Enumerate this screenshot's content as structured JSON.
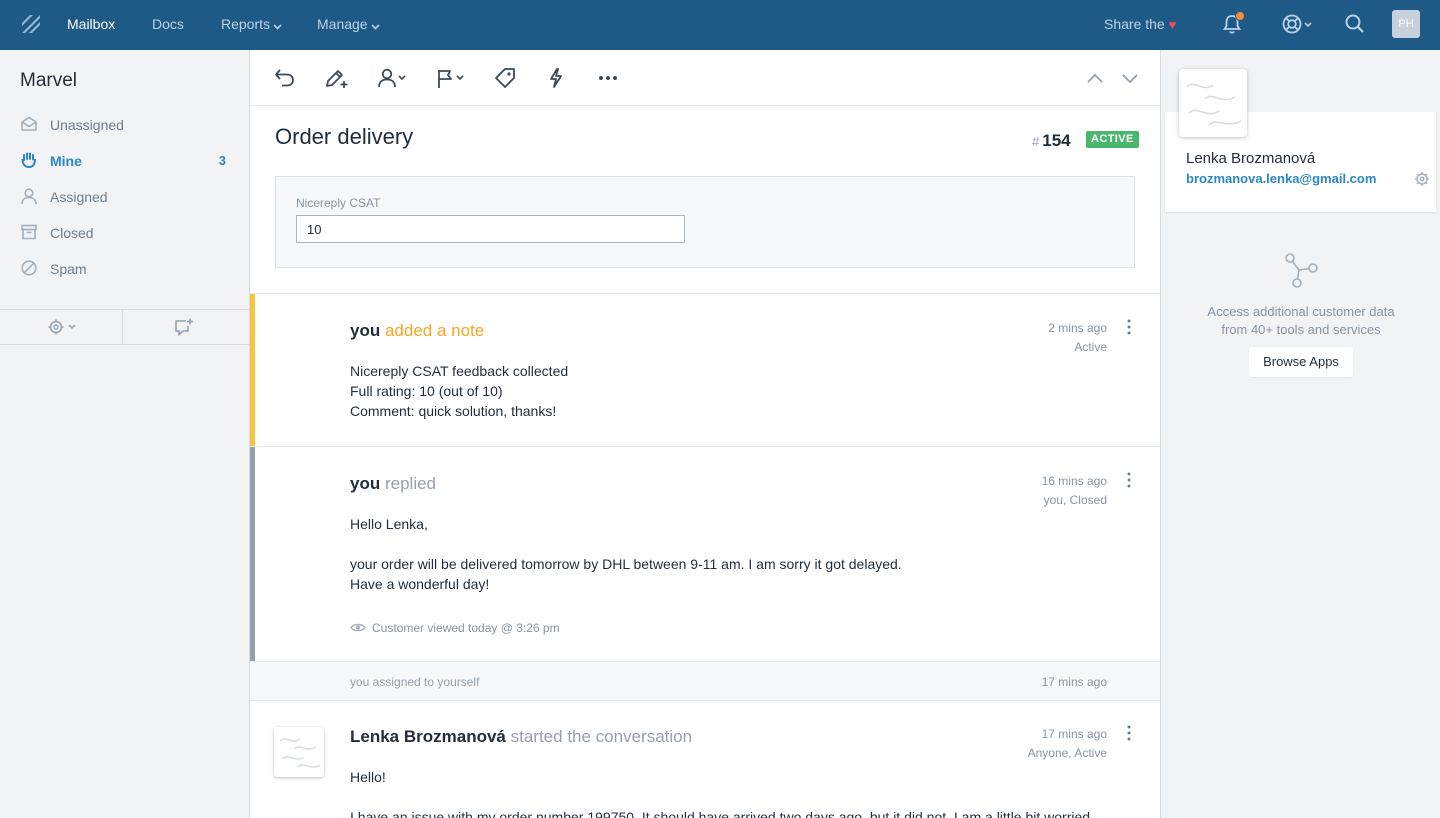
{
  "topnav": {
    "items": [
      {
        "label": "Mailbox"
      },
      {
        "label": "Docs"
      },
      {
        "label": "Reports"
      },
      {
        "label": "Manage"
      }
    ],
    "share_label": "Share the",
    "avatar_initials": "PH",
    "icons": [
      "logo-icon",
      "bell-icon",
      "help-icon",
      "search-icon"
    ],
    "colors": {
      "bar": "#1f5a87",
      "notification_dot": "#f68b32"
    }
  },
  "sidebar": {
    "mailbox_name": "Marvel",
    "folders": [
      {
        "label": "Unassigned",
        "icon": "envelope-open-icon"
      },
      {
        "label": "Mine",
        "icon": "hand-icon",
        "count": "3"
      },
      {
        "label": "Assigned",
        "icon": "person-icon"
      },
      {
        "label": "Closed",
        "icon": "archive-icon"
      },
      {
        "label": "Spam",
        "icon": "ban-icon"
      }
    ],
    "tools": [
      "settings-icon",
      "new-conversation-icon"
    ]
  },
  "conversation": {
    "toolbar_icons": [
      "undo-icon",
      "note-pen-icon",
      "assign-person-icon",
      "flag-status-icon",
      "tag-icon",
      "workflow-bolt-icon",
      "more-icon",
      "prev-icon",
      "next-icon"
    ],
    "subject": "Order delivery",
    "number_prefix": "#",
    "number": "154",
    "status": "ACTIVE",
    "custom_field": {
      "label": "Nicereply CSAT",
      "value": "10"
    },
    "threads": [
      {
        "who": "you",
        "action": "added a note",
        "time": "2 mins ago",
        "state": "Active",
        "body": [
          "Nicereply CSAT feedback collected",
          "Full rating: 10 (out of 10)",
          "Comment: quick solution, thanks!"
        ],
        "accent": "#f7c540"
      },
      {
        "who": "you",
        "action": "replied",
        "time": "16 mins ago",
        "state": "you, Closed",
        "body": [
          "Hello Lenka,",
          "your order will be delivered tomorrow by DHL between 9-11 am. I am sorry it got delayed.",
          "Have a wonderful day!"
        ],
        "viewed": "Customer viewed today @ 3:26 pm",
        "accent": "#93a1b0"
      },
      {
        "who": "Lenka Brozmanová",
        "action": "started the conversation",
        "time": "17 mins ago",
        "state": "Anyone, Active",
        "body": [
          "Hello!",
          "I have an issue with my order number 199750. It should have arrived two days ago, but it did not. I am a little bit worried"
        ]
      }
    ],
    "line_item": {
      "text": "you assigned to yourself",
      "time": "17 mins ago"
    }
  },
  "customer": {
    "name": "Lenka Brozmanová",
    "email": "brozmanova.lenka@gmail.com",
    "apps_text_1": "Access additional customer data",
    "apps_text_2": "from 40+ tools and services",
    "browse_label": "Browse Apps"
  }
}
